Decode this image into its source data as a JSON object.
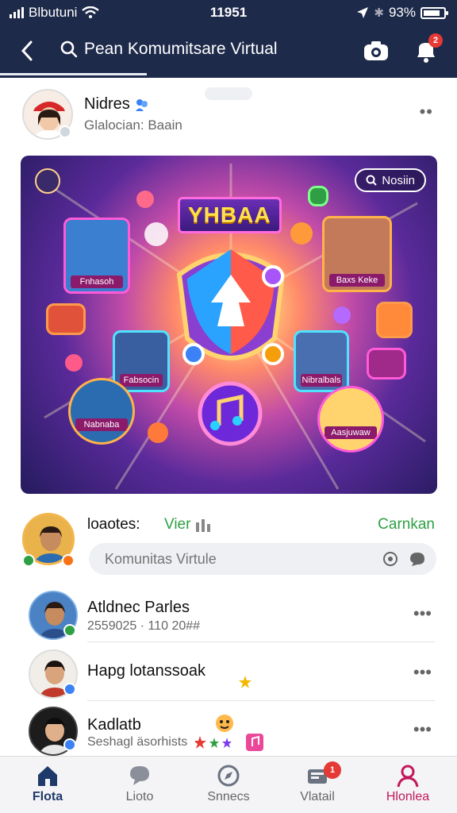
{
  "status_bar": {
    "carrier": "Blbutuni",
    "time": "11951",
    "battery": "93%"
  },
  "header": {
    "title": "Pean Komumitsare Virtual",
    "notification_count": "2"
  },
  "post": {
    "author": "Nidres",
    "subtitle": "Glalocian: Baain"
  },
  "hero": {
    "title": "YHBAA",
    "search_label": "Nosiin",
    "tile_labels": [
      "Fnhasoh",
      "Baxs Keke",
      "Fabsocin",
      "Nibralbals",
      "Nabnaba",
      "Aasjuwaw"
    ]
  },
  "comments": {
    "label": "loaotes:",
    "view_label": "Vier",
    "action_label": "Carnkan",
    "input_placeholder": "Komunitas Virtule"
  },
  "list": [
    {
      "name": "Atldnec Parles",
      "sub": "2559025 · 110 20##"
    },
    {
      "name": "Hapg lotanssoak",
      "sub": ""
    },
    {
      "name": "Kadlatb",
      "sub": "Seshagl äsorhists"
    }
  ],
  "nav": [
    {
      "label": "Flota",
      "icon": "home-icon",
      "active": true
    },
    {
      "label": "Lioto",
      "icon": "chat-icon"
    },
    {
      "label": "Snnecs",
      "icon": "explore-icon"
    },
    {
      "label": "Vlatail",
      "icon": "inbox-icon",
      "badge": "1"
    },
    {
      "label": "Hlonlea",
      "icon": "profile-icon"
    }
  ],
  "colors": {
    "header_bg": "#1e2a4a",
    "accent_green": "#2ea043",
    "active_nav": "#1e3a6a",
    "profile_nav": "#c2185b",
    "badge_red": "#e53935"
  }
}
